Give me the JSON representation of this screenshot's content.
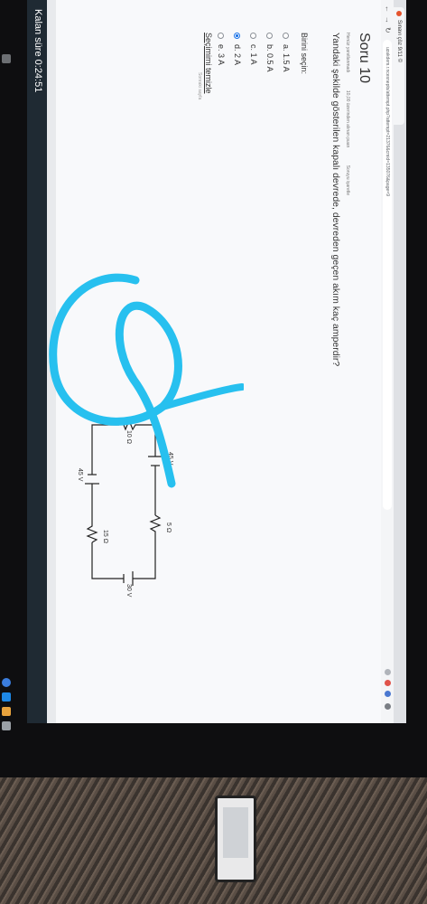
{
  "browser": {
    "tab_title": "Sınavı çöz 9/11 ©",
    "url": "uzakdem.r.ncesnepts/attempt.php?attempt=21376&cmid=135076&page=9"
  },
  "question": {
    "title": "Soru 10",
    "meta": [
      "Henüz yanıtlanmadı",
      "10,00 üzerinden alınan puan",
      "Soruyu işaretle"
    ],
    "text": "Yandaki şekilde gösterilen kapalı devrede, devreden geçen akım kaç amperdir?",
    "choose_label": "Birini seçin:",
    "options": [
      {
        "label": "a. 1.5 A",
        "selected": false
      },
      {
        "label": "b. 0.5 A",
        "selected": false
      },
      {
        "label": "c. 1 A",
        "selected": false
      },
      {
        "label": "d. 2 A",
        "selected": true
      },
      {
        "label": "e. 3 A",
        "selected": false
      }
    ],
    "clear_label": "Seçimimi temizle",
    "next_hint": "Sonraki sayfa"
  },
  "circuit": {
    "top_battery": "45 V",
    "top_resistor": "5 Ω",
    "left_resistor": "10 Ω",
    "right_battery": "30 V",
    "bottom_resistor": "15 Ω",
    "bottom_battery": "45 V"
  },
  "footer": {
    "timer": "Kalan süre 0:24:51"
  },
  "colors": {
    "scribble": "#27c0ef",
    "timer_bg": "#1f2a33",
    "selected": "#1a73e8"
  }
}
